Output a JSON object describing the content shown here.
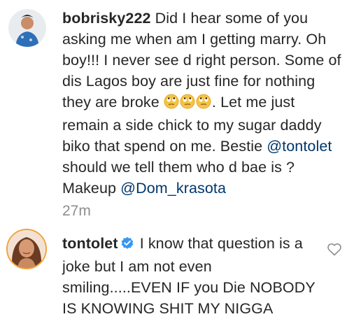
{
  "comments": [
    {
      "username": "bobrisky222",
      "body_part1": "Did I hear some of you asking me when am I getting marry. Oh boy!!! I never see d right person. Some of dis Lagos boy are just fine for nothing they are broke ",
      "emojis": [
        "rolling-eyes-emoji",
        "rolling-eyes-emoji",
        "rolling-eyes-emoji"
      ],
      "body_part2": ". Let me just remain a side chick to my sugar daddy biko that spend on me. Bestie ",
      "mention1": "@tontolet",
      "body_part3": " should we tell them who d bae is ? Makeup ",
      "mention2": "@Dom_krasota",
      "time": "27m"
    },
    {
      "username": "tontolet",
      "verified": true,
      "body": "I know that question is a joke but I am not even smiling.....EVEN IF you Die NOBODY IS KNOWING SHIT MY NIGGA",
      "like_icon": "heart-outline-icon"
    }
  ],
  "colors": {
    "text": "#262626",
    "mention": "#00376b",
    "meta": "#8e8e8e",
    "verified": "#3897f0"
  }
}
